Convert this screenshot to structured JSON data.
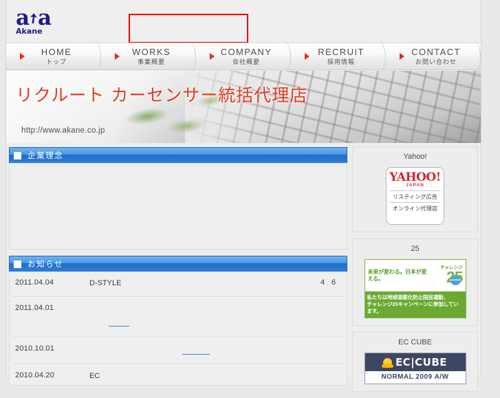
{
  "site": {
    "logo_mark_left": "a",
    "logo_mark_right": "a",
    "logo_arrow": "➚",
    "logo_word": "Akane"
  },
  "nav": {
    "items": [
      {
        "en": "HOME",
        "jp": "トップ",
        "icon": "triangle-right-icon"
      },
      {
        "en": "WORKS",
        "jp": "事業概要",
        "icon": "triangle-right-icon"
      },
      {
        "en": "COMPANY",
        "jp": "会社概要",
        "icon": "triangle-right-icon"
      },
      {
        "en": "RECRUIT",
        "jp": "採用情報",
        "icon": "triangle-right-icon"
      },
      {
        "en": "CONTACT",
        "jp": "お問い合わせ",
        "icon": "triangle-right-icon"
      }
    ]
  },
  "hero": {
    "title": "リクルート カーセンサー統括代理店",
    "url": "http://www.akane.co.jp"
  },
  "sections": {
    "philosophy": {
      "title": "企業理念",
      "icon": "white-square-icon"
    },
    "news": {
      "title": "お知らせ",
      "icon": "white-square-icon"
    }
  },
  "news": {
    "rows": [
      {
        "date": "2011.04.04",
        "text": "D-STYLE",
        "num1": "4",
        "num2": "6"
      },
      {
        "date": "2011.04.01",
        "text": "",
        "link": true
      },
      {
        "date": "2010.10.01",
        "text": "",
        "link": true
      },
      {
        "date": "2010.04.20",
        "text": "EC"
      }
    ]
  },
  "sidebar": {
    "widgets": [
      {
        "caption": "Yahoo!",
        "banner": {
          "logo": "YAHOO!",
          "sub": "JAPAN",
          "line1": "リスティング広告",
          "line2": "オンライン代理店"
        }
      },
      {
        "caption": "25",
        "banner": {
          "copy": "未来が変わる。日本が変える。",
          "word": "チャレンジ",
          "number": "25",
          "bottom1": "私たちは地球温暖化防止国民運動、",
          "bottom2": "チャレンジ25キャンペーンに参加しています。"
        }
      },
      {
        "caption": "EC CUBE",
        "banner": {
          "name": "EC|CUBE",
          "sub": "NORMAL 2009 A/W"
        }
      }
    ]
  },
  "annotation": {
    "highlight_color": "#f20000"
  },
  "colors": {
    "brand_blue": "#1a1a8c",
    "hero_red": "#e23a1e",
    "section_blue": "#2f7fd8",
    "nav_arrow_red": "#e03010"
  }
}
